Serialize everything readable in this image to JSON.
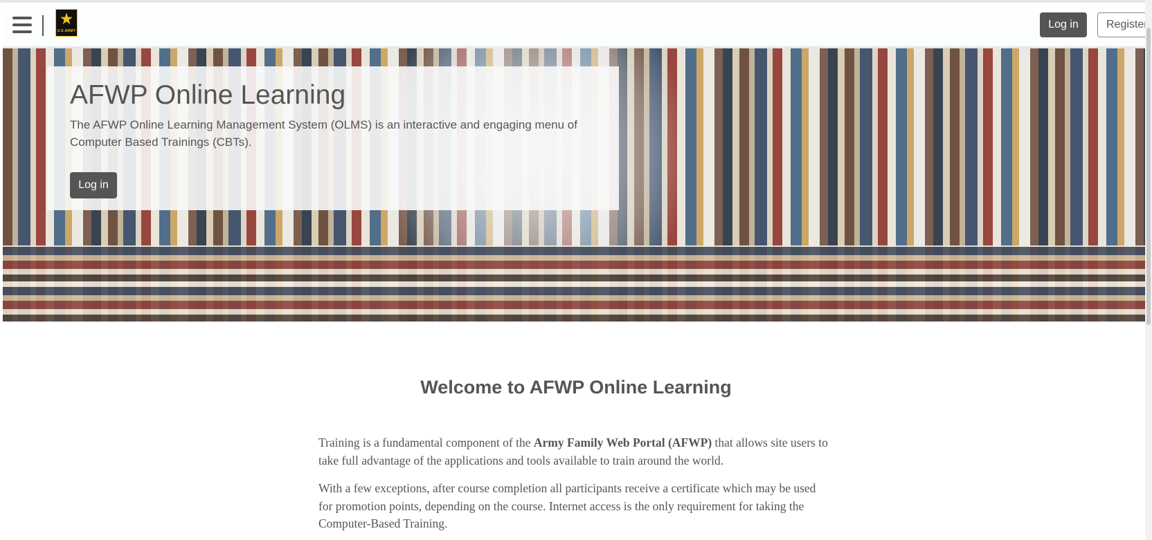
{
  "navbar": {
    "menu_icon": "hamburger-icon",
    "logo": {
      "icon": "army-star-icon",
      "text": "U.S.ARMY"
    },
    "login_label": "Log in",
    "register_label": "Register"
  },
  "hero": {
    "title": "AFWP Online Learning",
    "description": "The AFWP Online Learning Management System (OLMS) is an interactive and engaging menu of Computer Based Trainings (CBTs).",
    "login_label": "Log in"
  },
  "welcome": {
    "title": "Welcome to AFWP Online Learning",
    "paragraph1": {
      "before": "Training is a fundamental component of the ",
      "bold": "Army Family Web Portal (AFWP)",
      "after": " that allows site users to take full advantage of the applications and tools available to train around the world."
    },
    "paragraph2": "With a few exceptions, after course completion all participants receive a certificate which may be used for promotion points, depending on the course. Internet access is the only requirement for taking the Computer-Based Training."
  },
  "colors": {
    "button_dark": "#555555",
    "text": "#555555",
    "logo_gold": "#f0c419"
  }
}
